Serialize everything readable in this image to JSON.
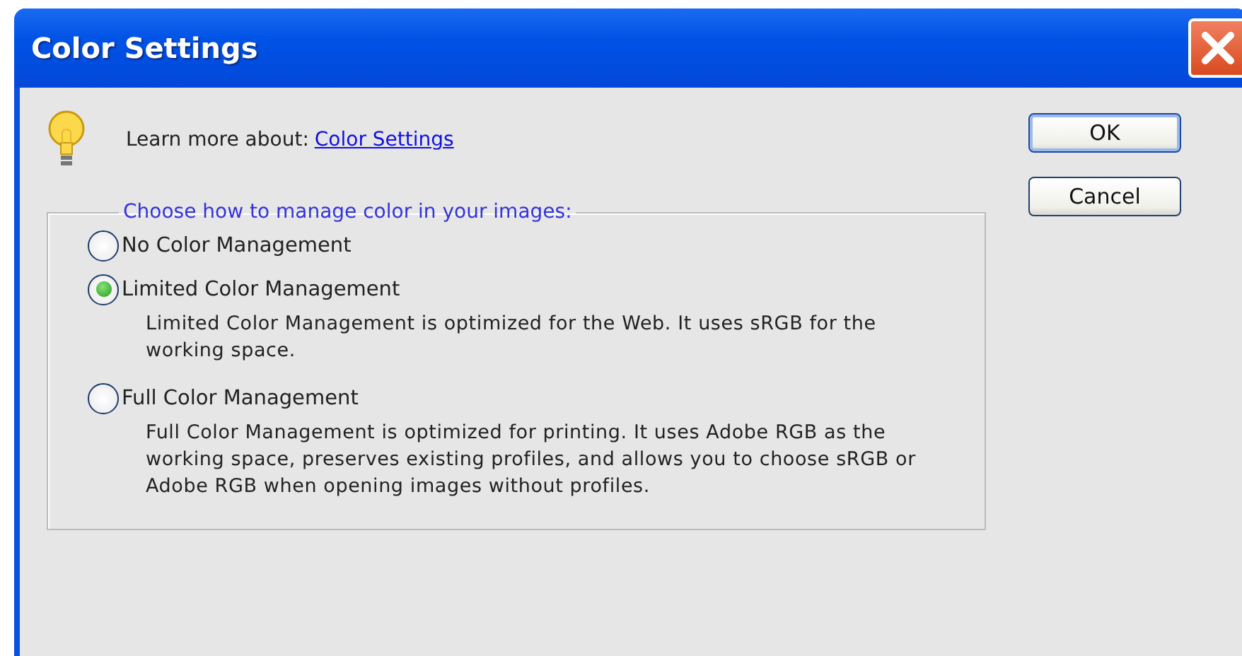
{
  "window": {
    "title": "Color Settings"
  },
  "learn_more": {
    "label": "Learn more about:",
    "link": "Color Settings"
  },
  "buttons": [
    {
      "label": "OK",
      "default": true
    },
    {
      "label": "Cancel",
      "default": false
    }
  ],
  "group": {
    "legend": "Choose how to manage color in your images:",
    "options": [
      {
        "label": "No Color Management",
        "selected": false
      },
      {
        "label": "Limited Color Management",
        "selected": true,
        "description": "Limited Color Management is optimized for the Web. It uses sRGB for the working space."
      },
      {
        "label": "Full Color Management",
        "selected": false,
        "description": "Full Color Management is optimized for printing. It uses Adobe RGB as the working space, preserves existing profiles, and allows you to choose sRGB or Adobe RGB when opening images without profiles."
      }
    ]
  }
}
